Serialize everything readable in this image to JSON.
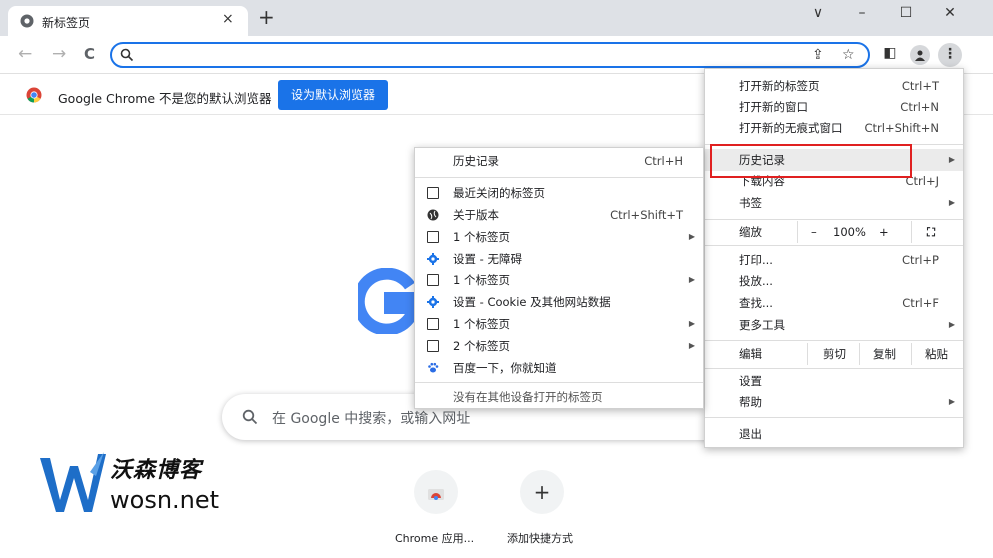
{
  "tab": {
    "title": "新标签页",
    "close": "×",
    "new_tab": "+"
  },
  "window_controls": {
    "chevron": "∨",
    "minimize": "–",
    "maximize": "☐",
    "close": "✕"
  },
  "toolbar": {
    "back": "←",
    "forward": "→",
    "reload": "C",
    "omnibox_value": "",
    "share": "⇪",
    "bookmark": "☆",
    "sidepanel": "◧",
    "profile": "👤",
    "menu": "⋮"
  },
  "infobar": {
    "message": "Google Chrome 不是您的默认浏览器",
    "button": "设为默认浏览器"
  },
  "search": {
    "placeholder": "在 Google 中搜索，或输入网址"
  },
  "shortcuts": [
    {
      "label": "Chrome 应用...",
      "icon": "chrome-web-store-icon"
    },
    {
      "label": "添加快捷方式",
      "icon": "+"
    }
  ],
  "watermark": {
    "cn": "沃森博客",
    "en": "wosn.net"
  },
  "main_menu": {
    "new_tab": {
      "label": "打开新的标签页",
      "shortcut": "Ctrl+T"
    },
    "new_window": {
      "label": "打开新的窗口",
      "shortcut": "Ctrl+N"
    },
    "incognito": {
      "label": "打开新的无痕式窗口",
      "shortcut": "Ctrl+Shift+N"
    },
    "history": {
      "label": "历史记录"
    },
    "downloads": {
      "label": "下载内容",
      "shortcut": "Ctrl+J"
    },
    "bookmarks": {
      "label": "书签"
    },
    "zoom": {
      "label": "缩放",
      "minus": "–",
      "value": "100%",
      "plus": "+"
    },
    "print": {
      "label": "打印...",
      "shortcut": "Ctrl+P"
    },
    "cast": {
      "label": "投放..."
    },
    "find": {
      "label": "查找...",
      "shortcut": "Ctrl+F"
    },
    "more_tools": {
      "label": "更多工具"
    },
    "edit": {
      "label": "编辑",
      "cut": "剪切",
      "copy": "复制",
      "paste": "粘贴"
    },
    "settings": {
      "label": "设置"
    },
    "help": {
      "label": "帮助"
    },
    "exit": {
      "label": "退出"
    }
  },
  "history_menu": {
    "header": {
      "label": "历史记录",
      "shortcut": "Ctrl+H"
    },
    "recently_closed": "最近关闭的标签页",
    "items": [
      {
        "label": "关于版本",
        "shortcut": "Ctrl+Shift+T",
        "icon": "globe",
        "arrow": false
      },
      {
        "label": "1 个标签页",
        "shortcut": "",
        "icon": "tab",
        "arrow": true
      },
      {
        "label": "设置 - 无障碍",
        "shortcut": "",
        "icon": "gear",
        "arrow": false
      },
      {
        "label": "1 个标签页",
        "shortcut": "",
        "icon": "tab",
        "arrow": true
      },
      {
        "label": "设置 - Cookie 及其他网站数据",
        "shortcut": "",
        "icon": "gear",
        "arrow": false
      },
      {
        "label": "1 个标签页",
        "shortcut": "",
        "icon": "tab",
        "arrow": true
      },
      {
        "label": "2 个标签页",
        "shortcut": "",
        "icon": "tab",
        "arrow": true
      },
      {
        "label": "百度一下，你就知道",
        "shortcut": "",
        "icon": "paw",
        "arrow": false
      }
    ],
    "footer": "没有在其他设备打开的标签页"
  }
}
